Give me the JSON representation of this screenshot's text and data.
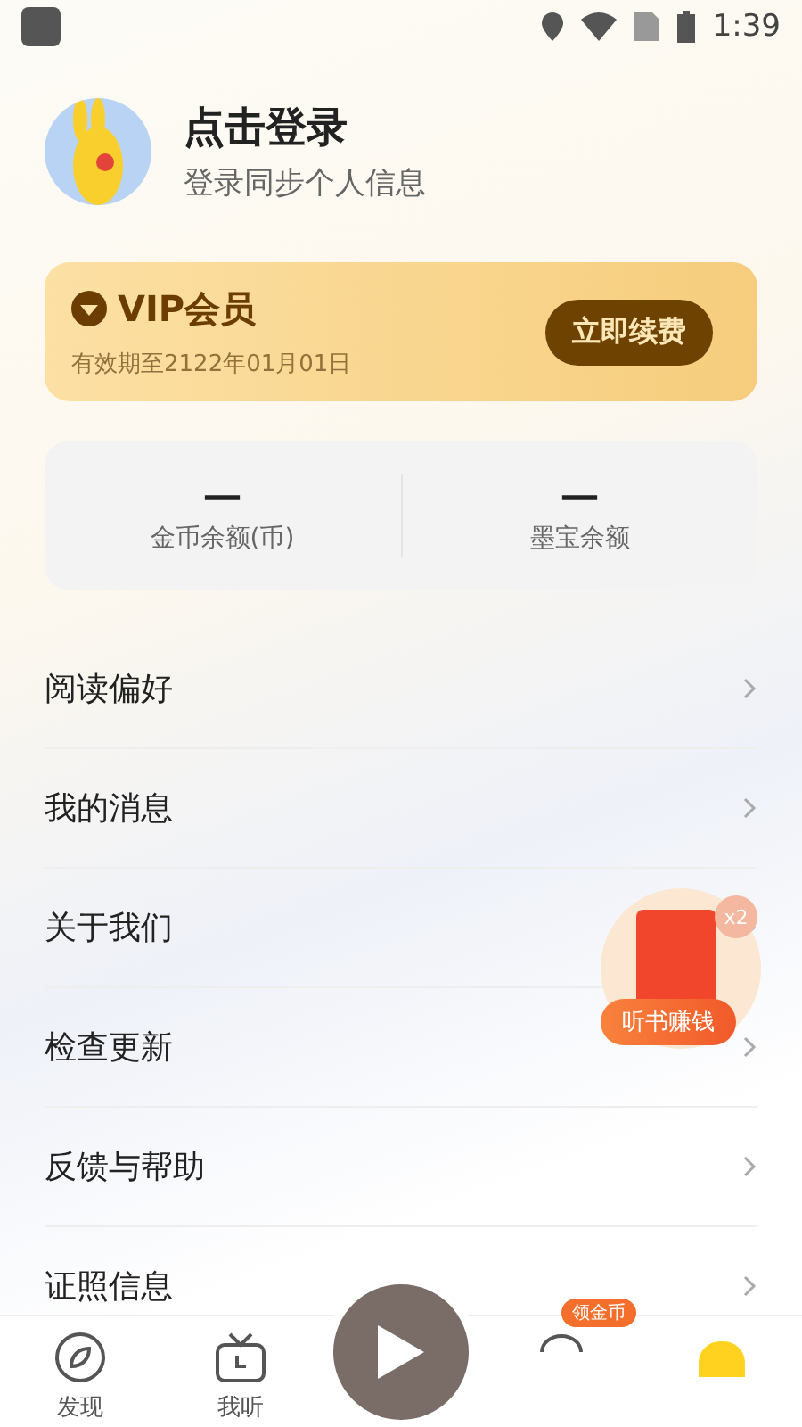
{
  "status_bar": {
    "time": "1:39"
  },
  "profile": {
    "title": "点击登录",
    "subtitle": "登录同步个人信息"
  },
  "vip": {
    "title": "VIP会员",
    "expiry": "有效期至2122年01月01日",
    "button": "立即续费"
  },
  "balances": [
    {
      "value": "—",
      "label": "金币余额(币)"
    },
    {
      "value": "—",
      "label": "墨宝余额"
    }
  ],
  "menu": [
    {
      "label": "阅读偏好"
    },
    {
      "label": "我的消息"
    },
    {
      "label": "关于我们"
    },
    {
      "label": "检查更新"
    },
    {
      "label": "反馈与帮助"
    },
    {
      "label": "证照信息"
    }
  ],
  "float_reward": {
    "badge": "x2",
    "label": "听书赚钱"
  },
  "tabs": [
    {
      "kind": "compass",
      "label": "发现"
    },
    {
      "kind": "tv",
      "label": "我听"
    },
    {
      "kind": "player"
    },
    {
      "kind": "coin",
      "badge": "领金币"
    },
    {
      "kind": "yellow"
    }
  ]
}
